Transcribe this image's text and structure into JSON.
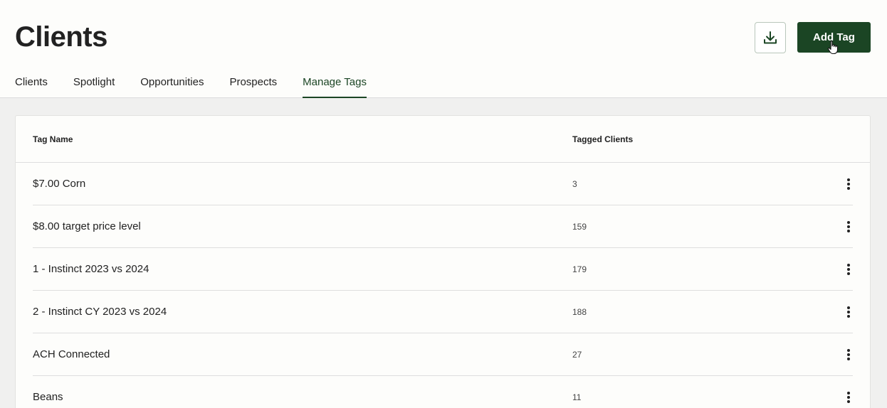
{
  "header": {
    "title": "Clients",
    "add_button_label": "Add Tag"
  },
  "tabs": [
    {
      "label": "Clients",
      "active": false
    },
    {
      "label": "Spotlight",
      "active": false
    },
    {
      "label": "Opportunities",
      "active": false
    },
    {
      "label": "Prospects",
      "active": false
    },
    {
      "label": "Manage Tags",
      "active": true
    }
  ],
  "table": {
    "columns": [
      "Tag Name",
      "Tagged Clients"
    ],
    "rows": [
      {
        "name": "$7.00 Corn",
        "count": "3"
      },
      {
        "name": "$8.00 target price level",
        "count": "159"
      },
      {
        "name": "1 - Instinct 2023 vs 2024",
        "count": "179"
      },
      {
        "name": "2 - Instinct CY 2023 vs 2024",
        "count": "188"
      },
      {
        "name": "ACH Connected",
        "count": "27"
      },
      {
        "name": "Beans",
        "count": "11"
      }
    ]
  },
  "icons": {
    "download": "download-icon",
    "row_menu": "more-vertical-icon"
  },
  "colors": {
    "accent": "#1b4524"
  }
}
